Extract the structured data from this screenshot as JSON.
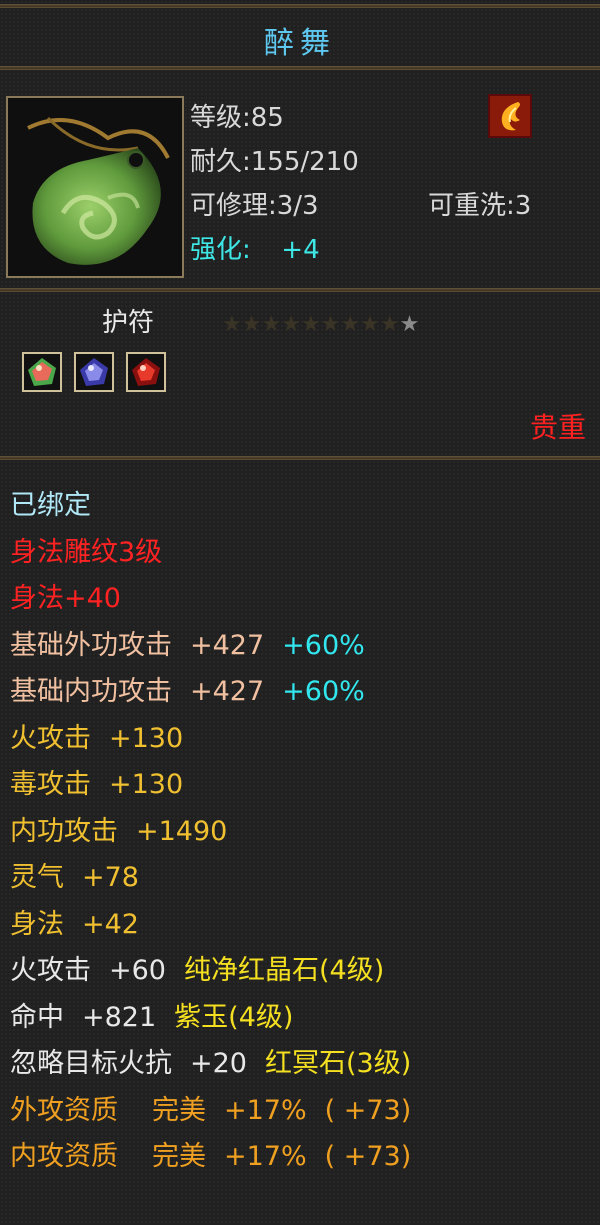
{
  "item": {
    "name": "醉舞",
    "type": "护符",
    "level_label": "等级:85",
    "durability_label": "耐久:155/210",
    "repair_label": "可修理:3/3",
    "rewash_label": "可重洗:3",
    "strengthen_label": "强化:",
    "strengthen_value": "+4",
    "stars": {
      "lit": 1,
      "total": 10
    },
    "rarity": "贵重",
    "bound": "已绑定"
  },
  "attributes": {
    "r1": {
      "text": "身法雕纹3级"
    },
    "r2": {
      "text": "身法+40"
    },
    "r3": {
      "name": "基础外功攻击",
      "value": "+427",
      "bonus": "+60%"
    },
    "r4": {
      "name": "基础内功攻击",
      "value": "+427",
      "bonus": "+60%"
    },
    "r5": {
      "name": "火攻击",
      "value": "+130"
    },
    "r6": {
      "name": "毒攻击",
      "value": "+130"
    },
    "r7": {
      "name": "内功攻击",
      "value": "+1490"
    },
    "r8": {
      "name": "灵气",
      "value": "+78"
    },
    "r9": {
      "name": "身法",
      "value": "+42"
    },
    "r10": {
      "name": "火攻击",
      "value": "+60",
      "gem": "纯净红晶石(4级)"
    },
    "r11": {
      "name": "命中",
      "value": "+821",
      "gem": "紫玉(4级)"
    },
    "r12": {
      "name": "忽略目标火抗",
      "value": "+20",
      "gem": "红冥石(3级)"
    },
    "r13": {
      "name": "外攻资质",
      "grade": "完美",
      "value": "+17%",
      "extra": "( +73)"
    },
    "r14": {
      "name": "内攻资质",
      "grade": "完美",
      "value": "+17%",
      "extra": "( +73)"
    }
  },
  "icons": {
    "item": "jade-amulet-icon",
    "element": "fire-element-icon",
    "gems": [
      "green-gem-icon",
      "purple-gem-icon",
      "red-gem-icon"
    ]
  },
  "colors": {
    "title": "#5ec8f0",
    "rarity": "#ff2020",
    "strengthen": "#3ee6e6",
    "gem_text": "#f4e020",
    "aptitude": "#f0a020"
  }
}
